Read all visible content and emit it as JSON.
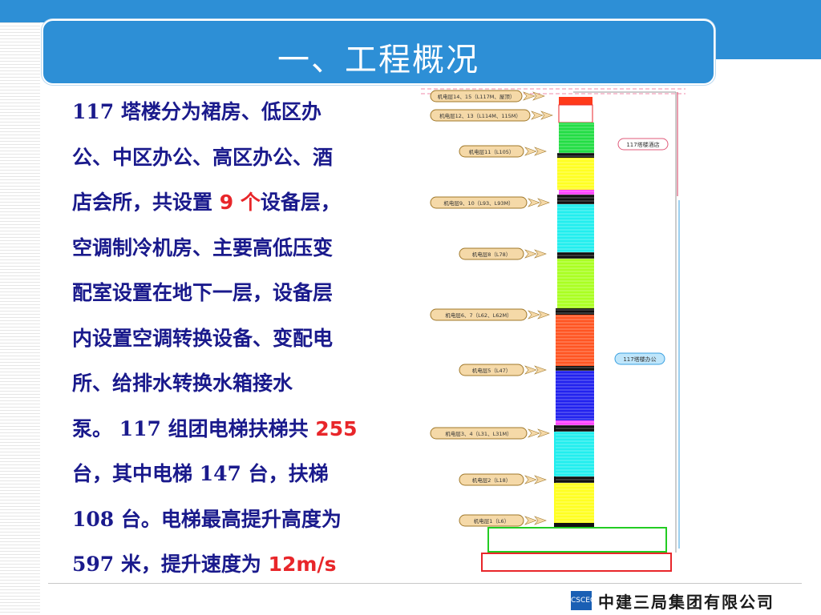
{
  "title": "一、工程概况",
  "body": {
    "lines": [
      {
        "parts": [
          {
            "t": "    117 塔楼分为裙房、低区办",
            "hl": false
          }
        ]
      },
      {
        "parts": [
          {
            "t": "公、中区办公、高区办公、酒",
            "hl": false
          }
        ]
      },
      {
        "parts": [
          {
            "t": "店会所，共设置 ",
            "hl": false
          },
          {
            "t": "9 个",
            "hl": true
          },
          {
            "t": "设备层，",
            "hl": false
          }
        ]
      },
      {
        "parts": [
          {
            "t": "空调制冷机房、主要高低压变",
            "hl": false
          }
        ]
      },
      {
        "parts": [
          {
            "t": "配室设置在地下一层，设备层",
            "hl": false
          }
        ]
      },
      {
        "parts": [
          {
            "t": "内设置空调转换设备、变配电",
            "hl": false
          }
        ]
      },
      {
        "parts": [
          {
            "t": "所、给排水转换水箱接水",
            "hl": false
          }
        ]
      },
      {
        "parts": [
          {
            "t": "泵。 117 组团电梯扶梯共 ",
            "hl": false
          },
          {
            "t": "255",
            "hl": true
          }
        ]
      },
      {
        "parts": [
          {
            "t": "台，其中电梯 147 台，扶梯",
            "hl": false
          }
        ]
      },
      {
        "parts": [
          {
            "t": "108 台。电梯最高提升高度为",
            "hl": false
          }
        ]
      },
      {
        "parts": [
          {
            "t": "597 米，提升速度为 ",
            "hl": false
          },
          {
            "t": "12m/s",
            "hl": true
          }
        ]
      }
    ]
  },
  "diagram": {
    "floor_labels": [
      "机电层14、15（L117M、屋顶）",
      "机电层12、13（L114M、115M）",
      "机电层11（L105）",
      "机电层9、10（L93、L93M）",
      "机电层8（L78）",
      "机电层6、7（L62、L62M）",
      "机电层5（L47）",
      "机电层3、4（L31、L31M）",
      "机电层2（L18）",
      "机电层1（L6）"
    ],
    "zone_labels": [
      "117塔楼酒店",
      "117塔楼办公"
    ]
  },
  "footer": {
    "logo_text": "CSCEC",
    "company": "中建三局集团有限公司"
  },
  "colors": {
    "primary_blue": "#2d8fd6",
    "text_blue": "#1a1a8c",
    "highlight_red": "#e8262a"
  }
}
